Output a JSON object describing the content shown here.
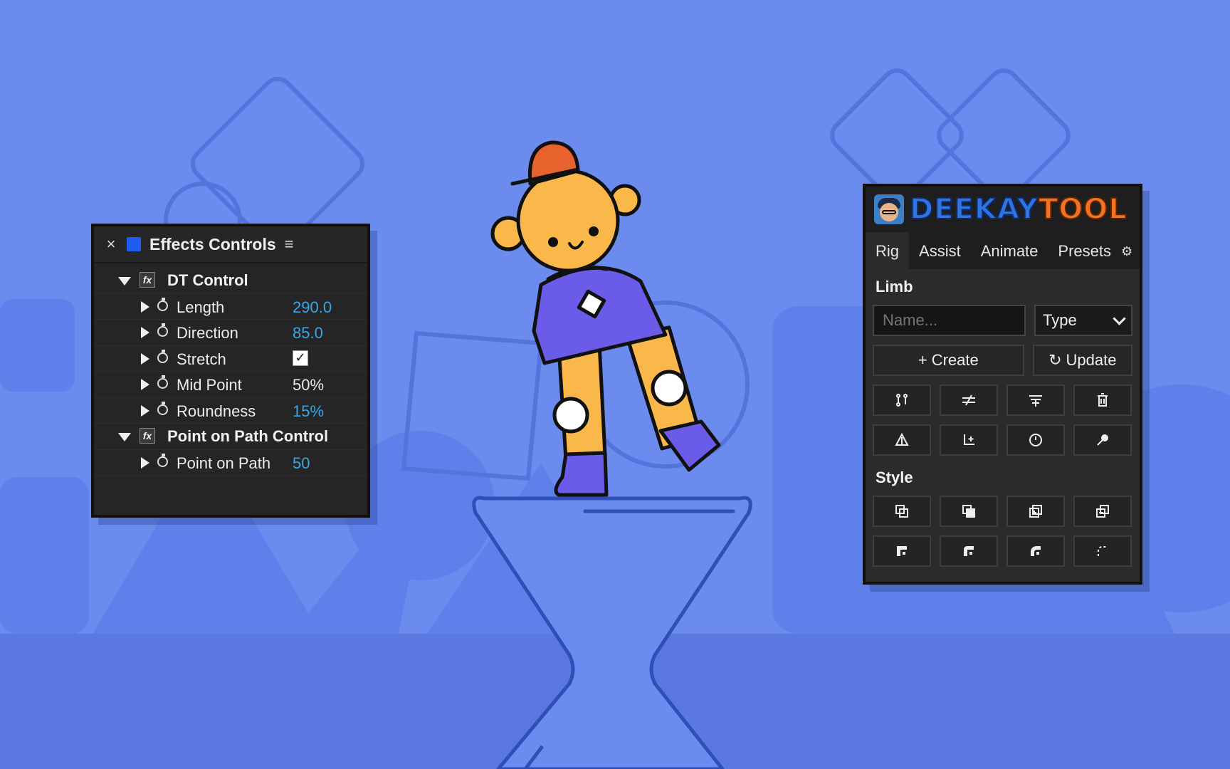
{
  "effects_controls": {
    "title": "Effects Controls",
    "close_glyph": "×",
    "menu_glyph": "≡",
    "swatch_color": "#1f5cf0",
    "groups": [
      {
        "name": "DT Control",
        "badge": "fx",
        "properties": [
          {
            "label": "Length",
            "value": "290.0",
            "value_color": "#39a6e6"
          },
          {
            "label": "Direction",
            "value": "85.0",
            "value_color": "#39a6e6"
          },
          {
            "label": "Stretch",
            "checked": true
          },
          {
            "label": "Mid Point",
            "value": "50%",
            "value_color": "#eaeaea"
          },
          {
            "label": "Roundness",
            "value": "15%",
            "value_color": "#39a6e6"
          }
        ]
      },
      {
        "name": "Point on Path Control",
        "badge": "fx",
        "properties": [
          {
            "label": "Point on Path",
            "value": "50",
            "value_color": "#39a6e6"
          }
        ]
      }
    ]
  },
  "deekay_tool": {
    "logo_part1": "DEEKAY",
    "logo_part2": "TOOL",
    "tabs": [
      "Rig",
      "Assist",
      "Animate",
      "Presets"
    ],
    "active_tab": "Rig",
    "settings_glyph": "⚙",
    "limb_section": "Limb",
    "name_placeholder": "Name...",
    "type_select": "Type",
    "create_label": "Create",
    "create_glyph": "+",
    "update_label": "Update",
    "update_glyph": "↻",
    "rig_icons": [
      "joint-chain-icon",
      "not-equal-icon",
      "filter-list-icon",
      "trash-icon",
      "pin-triangle-icon",
      "add-parent-icon",
      "clock-icon",
      "eyedropper-icon"
    ],
    "style_section": "Style",
    "style_icons": [
      "layer-front-icon",
      "layer-back-icon",
      "layer-add-icon",
      "layer-stack-icon",
      "corner-sharp-icon",
      "corner-round-icon",
      "corner-bend-icon",
      "corner-dashed-icon"
    ]
  },
  "colors": {
    "background": "#6b8bef",
    "background_shapes": "#5d7de6",
    "shape_outline": "#3b5fcf",
    "character_skin": "#fbb84a",
    "character_hat": "#e8622d",
    "character_shirt": "#6a5ce8",
    "cursor": "#2f82e0"
  }
}
